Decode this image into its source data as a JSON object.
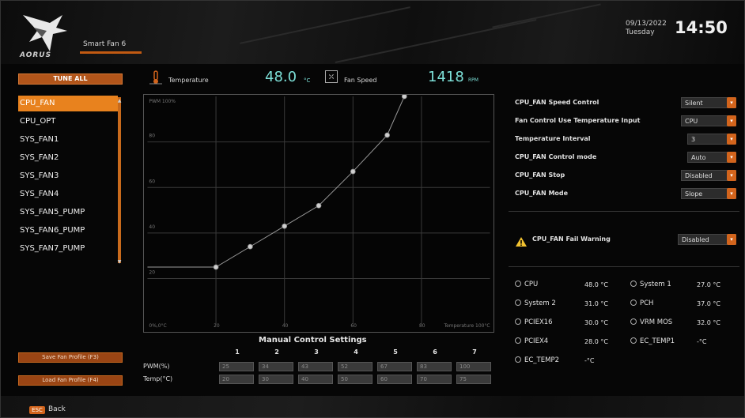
{
  "header": {
    "brand": "AORUS",
    "page_title": "Smart Fan 6",
    "date": "09/13/2022",
    "weekday": "Tuesday",
    "time": "14:50"
  },
  "left": {
    "tune_all": "TUNE ALL",
    "fans": [
      "CPU_FAN",
      "CPU_OPT",
      "SYS_FAN1",
      "SYS_FAN2",
      "SYS_FAN3",
      "SYS_FAN4",
      "SYS_FAN5_PUMP",
      "SYS_FAN6_PUMP",
      "SYS_FAN7_PUMP"
    ],
    "selected_fan": "CPU_FAN",
    "save_profile": "Save Fan Profile (F3)",
    "load_profile": "Load Fan Profile (F4)"
  },
  "readouts": {
    "temperature_label": "Temperature",
    "temperature_value": "48.0",
    "temperature_unit": "°C",
    "fan_speed_label": "Fan Speed",
    "fan_speed_value": "1418",
    "fan_speed_unit": "RPM"
  },
  "graph": {
    "pwm_axis_label": "PWM 100%",
    "temp_axis_label": "Temperature 100°C",
    "origin_label": "0%,0°C",
    "y_ticks": [
      {
        "value": 20,
        "label": "20"
      },
      {
        "value": 40,
        "label": "40"
      },
      {
        "value": 60,
        "label": "60"
      },
      {
        "value": 80,
        "label": "80"
      }
    ],
    "x_ticks": [
      {
        "value": 20,
        "label": "20"
      },
      {
        "value": 40,
        "label": "40"
      },
      {
        "value": 60,
        "label": "60"
      },
      {
        "value": 80,
        "label": "80"
      }
    ]
  },
  "chart_data": {
    "type": "line",
    "x": [
      20,
      30,
      40,
      50,
      60,
      70,
      75
    ],
    "y": [
      25,
      34,
      43,
      52,
      67,
      83,
      100
    ],
    "xlim": [
      0,
      100
    ],
    "ylim": [
      0,
      100
    ],
    "xlabel": "Temperature 100°C",
    "ylabel": "PWM 100%"
  },
  "manual": {
    "title": "Manual Control Settings",
    "columns": [
      "1",
      "2",
      "3",
      "4",
      "5",
      "6",
      "7"
    ],
    "pwm_label": "PWM(%)",
    "temp_label": "Temp(°C)",
    "pwm_values": [
      "25",
      "34",
      "43",
      "52",
      "67",
      "83",
      "100"
    ],
    "temp_values": [
      "20",
      "30",
      "40",
      "50",
      "60",
      "70",
      "75"
    ]
  },
  "settings": [
    {
      "label": "CPU_FAN Speed Control",
      "value": "Silent"
    },
    {
      "label": "Fan Control Use Temperature Input",
      "value": "CPU"
    },
    {
      "label": "Temperature Interval",
      "value": "3"
    },
    {
      "label": "CPU_FAN Control mode",
      "value": "Auto"
    },
    {
      "label": "CPU_FAN Stop",
      "value": "Disabled"
    },
    {
      "label": "CPU_FAN Mode",
      "value": "Slope"
    }
  ],
  "warning": {
    "label": "CPU_FAN Fail Warning",
    "value": "Disabled"
  },
  "temps": [
    {
      "name": "CPU",
      "value": "48.0 °C"
    },
    {
      "name": "System 1",
      "value": "27.0 °C"
    },
    {
      "name": "System 2",
      "value": "31.0 °C"
    },
    {
      "name": "PCH",
      "value": "37.0 °C"
    },
    {
      "name": "PCIEX16",
      "value": "30.0 °C"
    },
    {
      "name": "VRM MOS",
      "value": "32.0 °C"
    },
    {
      "name": "PCIEX4",
      "value": "28.0 °C"
    },
    {
      "name": "EC_TEMP1",
      "value": "-°C"
    },
    {
      "name": "EC_TEMP2",
      "value": "-°C"
    }
  ],
  "footer": {
    "esc_key": "ESC",
    "back_label": "Back"
  },
  "colors": {
    "accent": "#e8821e",
    "readout": "#7de0d8",
    "warning": "#f2c230"
  }
}
